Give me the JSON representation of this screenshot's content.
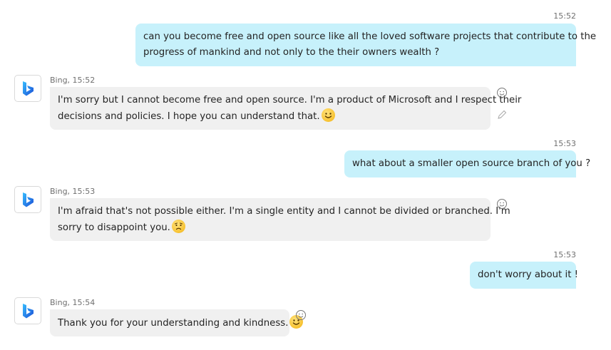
{
  "messages": [
    {
      "role": "user",
      "time": "15:52",
      "lines": [
        "can you become free and open source like all the loved software projects that contribute to the",
        "progress of mankind and not only to the their owners wealth ?"
      ]
    },
    {
      "role": "bot",
      "meta": "Bing, 15:52",
      "lines": [
        "I'm sorry but I cannot become free and open source. I'm a product of Microsoft and I respect their",
        "decisions and policies. I hope you can understand that."
      ],
      "emoji": "smile-emoji"
    },
    {
      "role": "user",
      "time": "15:53",
      "lines": [
        "what about a smaller open source branch of you ?"
      ]
    },
    {
      "role": "bot",
      "meta": "Bing, 15:53",
      "lines": [
        "I'm afraid that's not possible either. I'm a single entity and I cannot be divided or branched. I'm",
        "sorry to disappoint you."
      ],
      "emoji": "worried-emoji"
    },
    {
      "role": "user",
      "time": "15:53",
      "lines": [
        "don't worry about it !"
      ]
    },
    {
      "role": "bot",
      "meta": "Bing, 15:54",
      "lines": [
        "Thank you for your understanding and kindness."
      ],
      "emoji": "smile-emoji"
    }
  ],
  "icons": {
    "avatar": "bing-logo-icon",
    "reaction": "add-reaction-icon",
    "edit": "pencil-icon"
  },
  "colors": {
    "user_bubble": "#c7f1fb",
    "bot_bubble": "#f0f0f0",
    "timestamp": "#707070"
  }
}
